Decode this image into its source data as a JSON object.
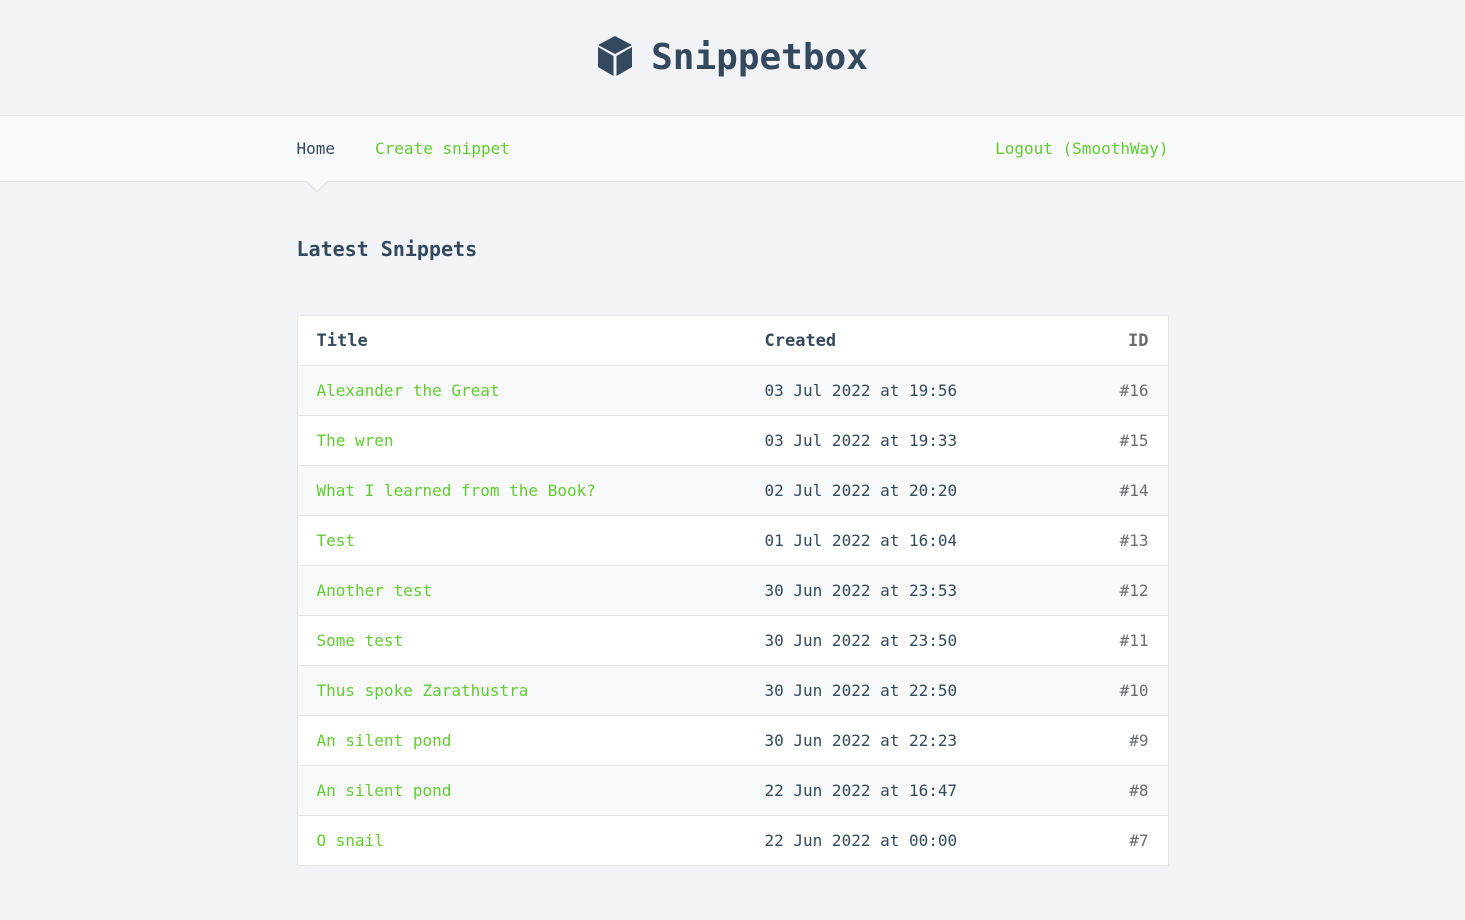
{
  "header": {
    "brand": "Snippetbox",
    "logo_icon": "cube-icon"
  },
  "nav": {
    "home_label": "Home",
    "create_label": "Create snippet",
    "logout_label": "Logout (SmoothWay)"
  },
  "main": {
    "heading": "Latest Snippets",
    "table": {
      "headers": {
        "title": "Title",
        "created": "Created",
        "id": "ID"
      },
      "rows": [
        {
          "title": "Alexander the Great",
          "created": "03 Jul 2022 at 19:56",
          "id": "#16"
        },
        {
          "title": "The wren",
          "created": "03 Jul 2022 at 19:33",
          "id": "#15"
        },
        {
          "title": "What I learned from the Book?",
          "created": "02 Jul 2022 at 20:20",
          "id": "#14"
        },
        {
          "title": "Test",
          "created": "01 Jul 2022 at 16:04",
          "id": "#13"
        },
        {
          "title": "Another test",
          "created": "30 Jun 2022 at 23:53",
          "id": "#12"
        },
        {
          "title": "Some test",
          "created": "30 Jun 2022 at 23:50",
          "id": "#11"
        },
        {
          "title": "Thus spoke Zarathustra",
          "created": "30 Jun 2022 at 22:50",
          "id": "#10"
        },
        {
          "title": "An silent pond",
          "created": "30 Jun 2022 at 22:23",
          "id": "#9"
        },
        {
          "title": "An silent pond",
          "created": "22 Jun 2022 at 16:47",
          "id": "#8"
        },
        {
          "title": "O snail",
          "created": "22 Jun 2022 at 00:00",
          "id": "#7"
        }
      ]
    }
  },
  "colors": {
    "accent": "#62cb31",
    "text": "#34495e",
    "background": "#f1f3f6"
  }
}
